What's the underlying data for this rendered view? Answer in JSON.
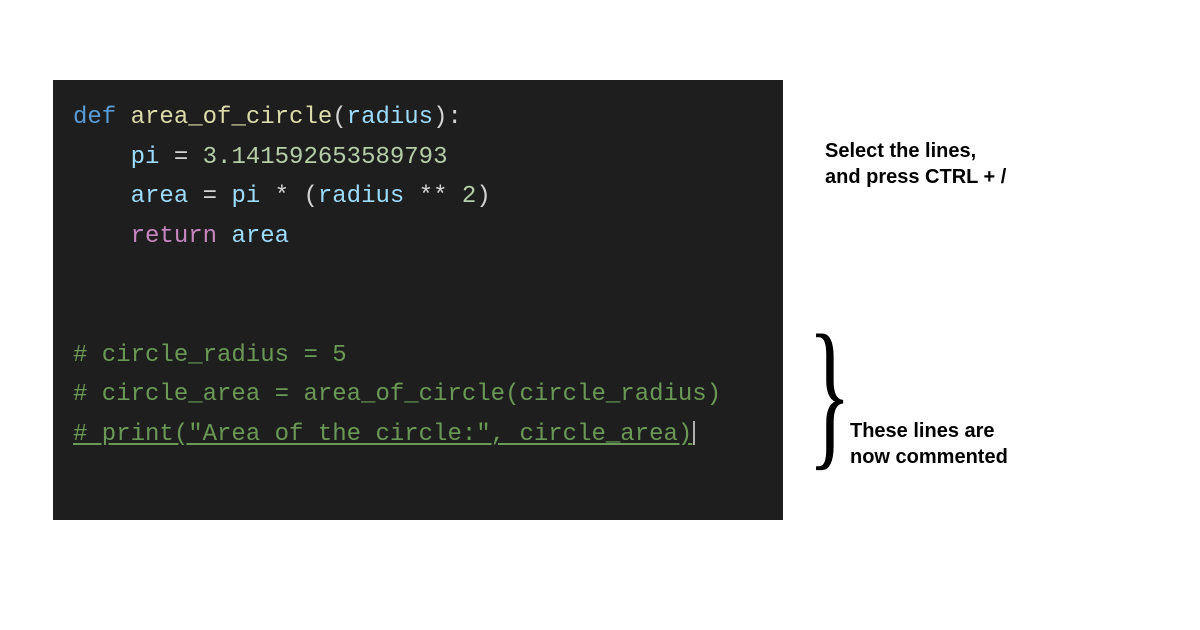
{
  "annotations": {
    "top_line1": "Select the lines,",
    "top_line2": "and press CTRL + /",
    "bottom_line1": "These lines are",
    "bottom_line2": "now commented"
  },
  "code": {
    "line1": {
      "def": "def",
      "fn": "area_of_circle",
      "lparen": "(",
      "param": "radius",
      "rparen_colon": "):"
    },
    "line2": {
      "indent": "    ",
      "var": "pi",
      "eq": " = ",
      "num": "3.141592653589793"
    },
    "line3": {
      "indent": "    ",
      "var": "area",
      "eq": " = ",
      "pi": "pi",
      "mul": " * ",
      "lp": "(",
      "radius": "radius",
      "pow": " ** ",
      "two": "2",
      "rp": ")"
    },
    "line4": {
      "indent": "    ",
      "ret": "return",
      "sp": " ",
      "var": "area"
    },
    "line7": {
      "comment": "# circle_radius = 5"
    },
    "line8": {
      "comment": "# circle_area = area_of_circle(circle_radius)"
    },
    "line9": {
      "comment": "# print(\"Area of the circle:\", circle_area)"
    }
  }
}
